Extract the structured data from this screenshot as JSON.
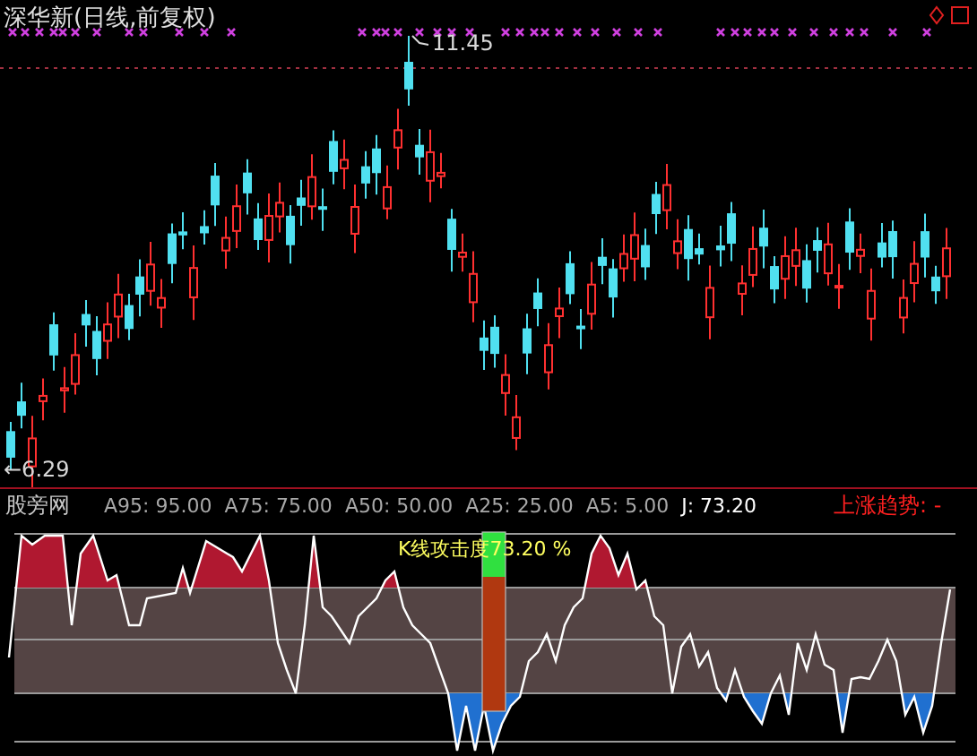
{
  "title": "深华新(日线,前复权)",
  "high_label": "11.45",
  "low_label": "←6.29",
  "indicator": {
    "name": "股旁网",
    "params": [
      {
        "text": "A95: 95.00"
      },
      {
        "text": "A75: 75.00"
      },
      {
        "text": "A50: 50.00"
      },
      {
        "text": "A25: 25.00"
      },
      {
        "text": "A5: 5.00"
      }
    ],
    "j_value": "J: 73.20",
    "trend": "上涨趋势: -",
    "gauge": {
      "label": "K线攻击度73.20 %",
      "level": 0.75
    }
  }
}
